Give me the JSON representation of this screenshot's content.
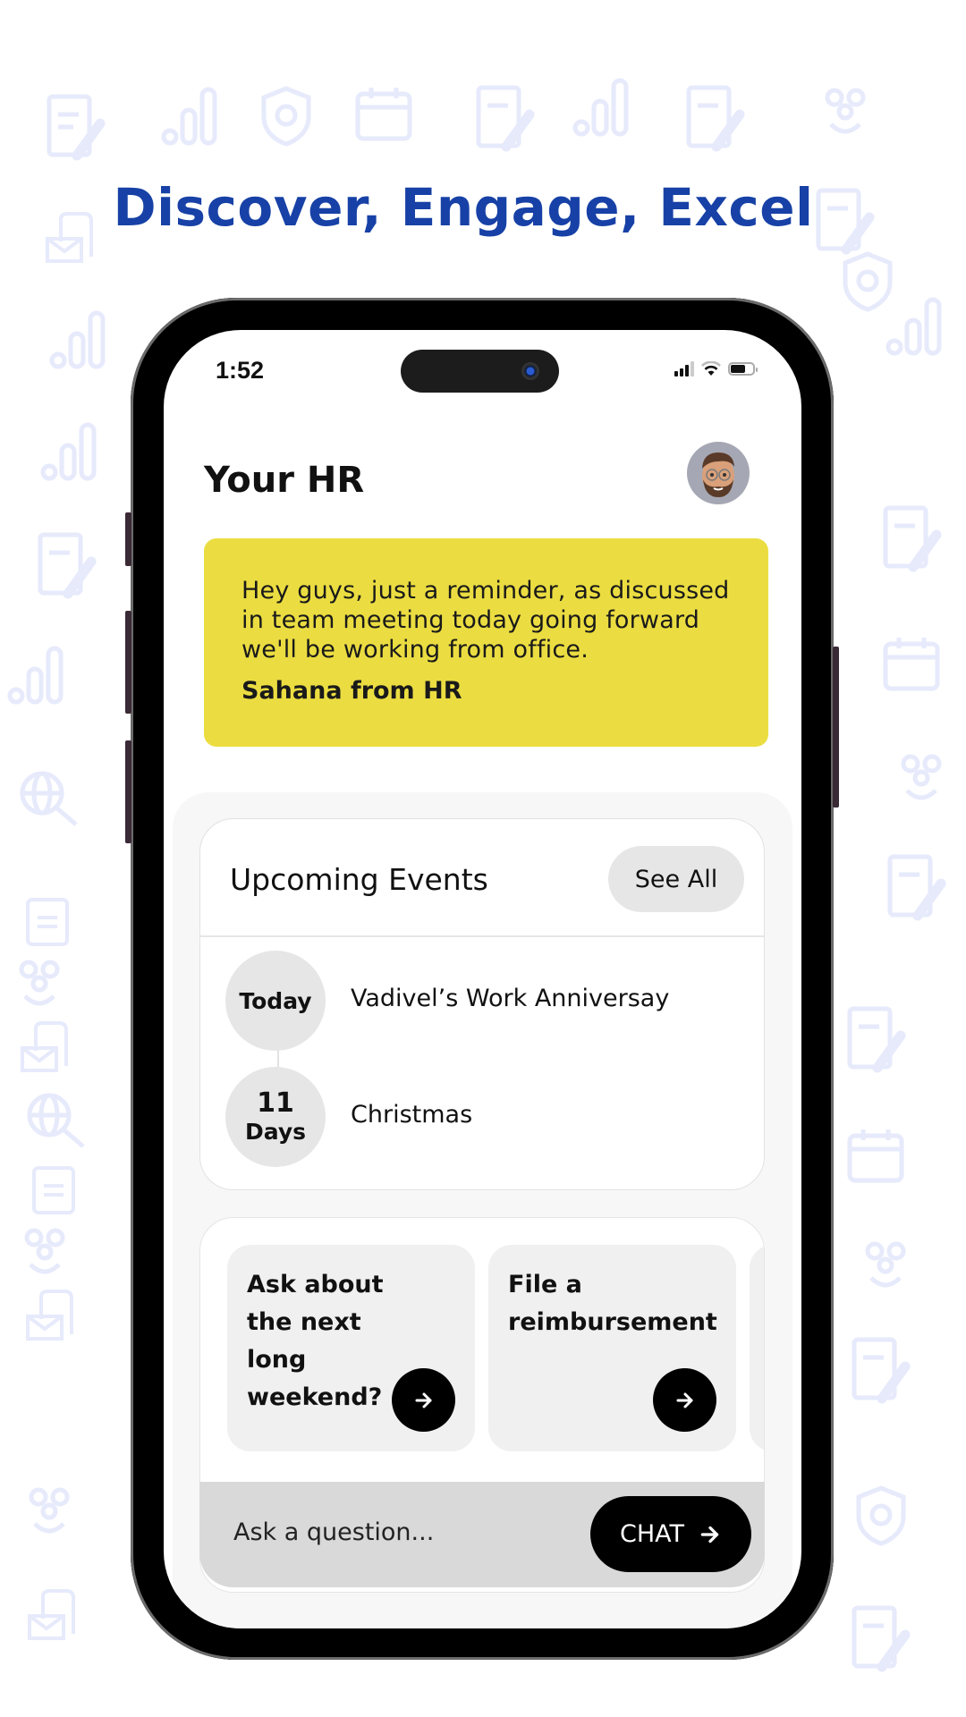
{
  "headline": "Discover, Engage, Excel",
  "status_bar": {
    "time": "1:52",
    "signal": "signal-icon",
    "wifi": "wifi-icon",
    "battery": "battery-icon"
  },
  "header": {
    "title": "Your HR",
    "avatar": "memoji-avatar"
  },
  "announcement": {
    "message": "Hey guys, just a reminder, as discussed in team meeting today going forward we'll be working from office.",
    "from": "Sahana from HR",
    "background": "#ebdd41"
  },
  "events": {
    "title": "Upcoming Events",
    "see_all_label": "See All",
    "items": [
      {
        "badge": "Today",
        "badge_num": "",
        "badge_unit": "",
        "name": "Vadivel’s Work Anniversay"
      },
      {
        "badge": "",
        "badge_num": "11",
        "badge_unit": "Days",
        "name": "Christmas"
      }
    ]
  },
  "quick_actions": [
    {
      "label": "Ask about the next long weekend?",
      "icon": "arrow-right-icon"
    },
    {
      "label": "File a reimbursement",
      "icon": "arrow-right-icon"
    }
  ],
  "ask": {
    "placeholder": "Ask a question...",
    "value": "",
    "chat_label": "CHAT"
  },
  "colors": {
    "headline": "#1741a6",
    "accent_yellow": "#ebdd41",
    "pattern": "#e6eafb"
  }
}
